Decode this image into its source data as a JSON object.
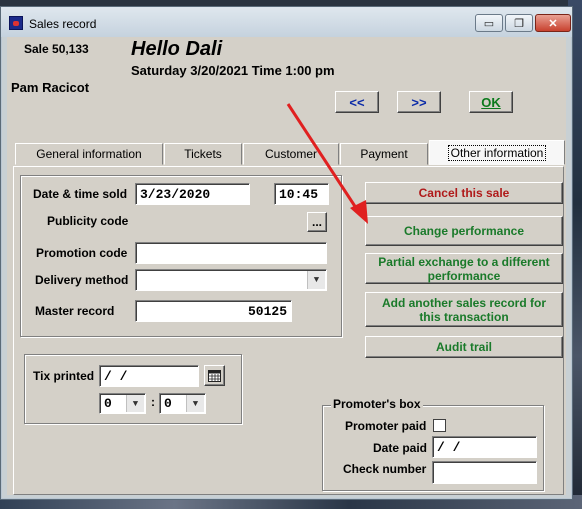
{
  "window": {
    "title": "Sales record",
    "controls": {
      "minimize": "▭",
      "maximize": "❐",
      "close": "✕"
    }
  },
  "header": {
    "sale_number": "Sale 50,133",
    "greeting": "Hello Dali",
    "date_time": "Saturday 3/20/2021  Time 1:00 pm",
    "client_name": "Pam Racicot"
  },
  "nav": {
    "prev": "<<",
    "next": ">>",
    "ok": "OK"
  },
  "tabs": [
    {
      "label": "General information",
      "active": false
    },
    {
      "label": "Tickets",
      "active": false
    },
    {
      "label": "Customer",
      "active": false
    },
    {
      "label": "Payment",
      "active": false
    },
    {
      "label": "Other information",
      "active": true
    }
  ],
  "form": {
    "date_time_sold_label": "Date & time sold",
    "date_sold": "3/23/2020",
    "time_sold": "10:45",
    "publicity_code_label": "Publicity code",
    "publicity_button": "...",
    "promotion_code_label": "Promotion code",
    "promotion_code": "",
    "delivery_method_label": "Delivery method",
    "delivery_method": "",
    "master_record_label": "Master record",
    "master_record": "50125"
  },
  "tix": {
    "label": "Tix printed",
    "date": " /  /",
    "hour": "0",
    "minute": "0",
    "colon": ":"
  },
  "actions": {
    "cancel": "Cancel this sale",
    "change_performance": "Change performance",
    "partial_exchange": "Partial exchange to a different performance",
    "add_sales_record": "Add another sales record for this transaction",
    "audit_trail": "Audit trail"
  },
  "promoter": {
    "legend": "Promoter's box",
    "paid_label": "Promoter paid",
    "date_paid_label": "Date paid",
    "date_paid": " /  /",
    "check_number_label": "Check number",
    "check_number": ""
  },
  "colors": {
    "annotation_arrow": "#e02020",
    "cancel_text": "#b01a1a",
    "action_text": "#1a7a2a"
  }
}
